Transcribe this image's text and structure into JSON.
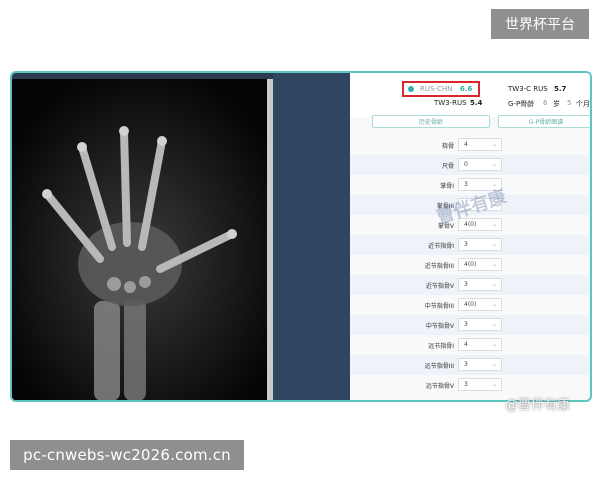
{
  "watermark": {
    "top_right": "世界杯平台",
    "url": "pc-cnwebs-wc2026.com.cn",
    "center": "曹伴有康",
    "bottom_right": "@曹伴有康"
  },
  "header": {
    "rus_chn_label": "RUS-CHN",
    "rus_chn_value": "6.6",
    "tw3c_label": "TW3-C RUS",
    "tw3c_value": "5.7",
    "tw3rus_label": "TW3-RUS",
    "tw3rus_value": "5.4",
    "gp_label": "G-P骨龄",
    "gp_years": "6",
    "gp_years_unit": "岁",
    "gp_months": "5",
    "gp_months_unit": "个月"
  },
  "buttons": {
    "history": "历史骨龄",
    "gp_map": "G-P骨龄图谱"
  },
  "rows": [
    {
      "label": "桡骨",
      "value": "4"
    },
    {
      "label": "尺骨",
      "value": "0"
    },
    {
      "label": "掌骨I",
      "value": "3"
    },
    {
      "label": "掌骨III",
      "value": ""
    },
    {
      "label": "掌骨V",
      "value": "4(0)"
    },
    {
      "label": "近节指骨I",
      "value": "3"
    },
    {
      "label": "近节指骨III",
      "value": "4(0)"
    },
    {
      "label": "近节指骨V",
      "value": "3"
    },
    {
      "label": "中节指骨III",
      "value": "4(0)"
    },
    {
      "label": "中节指骨V",
      "value": "3"
    },
    {
      "label": "远节指骨I",
      "value": "4"
    },
    {
      "label": "远节指骨III",
      "value": "3"
    },
    {
      "label": "远节指骨V",
      "value": "3"
    }
  ],
  "colors": {
    "frame": "#5ec6c0",
    "highlight": "#d9262c",
    "panel": "#2f4560"
  }
}
